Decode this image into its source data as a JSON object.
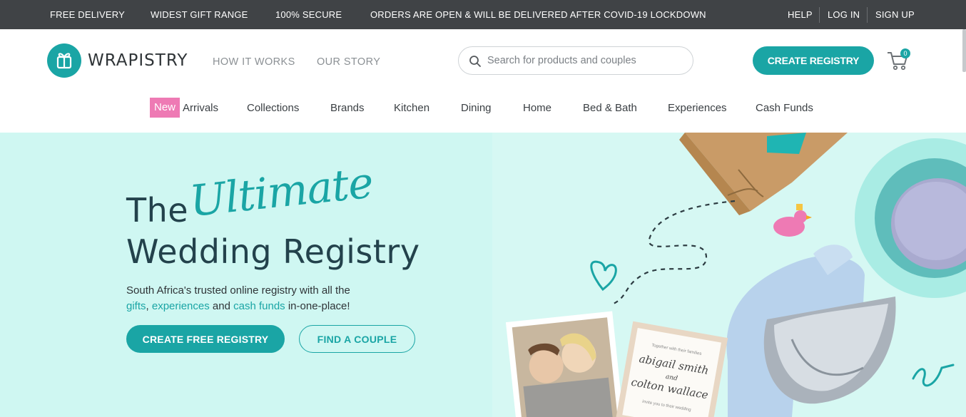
{
  "topbar": {
    "items": [
      "FREE DELIVERY",
      "WIDEST GIFT RANGE",
      "100% SECURE",
      "ORDERS ARE OPEN & WILL BE DELIVERED AFTER COVID-19 LOCKDOWN"
    ],
    "help": "HELP",
    "login": "LOG IN",
    "signup": "SIGN UP"
  },
  "header": {
    "brand": "WRAPISTRY",
    "nav": [
      "HOW IT WORKS",
      "OUR STORY"
    ],
    "search_placeholder": "Search for products and couples",
    "create_registry": "CREATE REGISTRY",
    "cart_count": "0"
  },
  "categories": {
    "new_badge": "New",
    "items": [
      "Arrivals",
      "Collections",
      "Brands",
      "Kitchen",
      "Dining",
      "Home",
      "Bed & Bath",
      "Experiences",
      "Cash Funds"
    ]
  },
  "hero": {
    "title_the": "The",
    "title_script": "Ultimate",
    "title_line2": "Wedding Registry",
    "desc_line1": "South Africa's trusted online registry with all the",
    "link_gifts": "gifts",
    "comma": ",",
    "link_experiences": "experiences",
    "and": "and",
    "link_cash": "cash funds",
    "desc_end": "in-one-place!",
    "btn_primary": "CREATE FREE REGISTRY",
    "btn_secondary": "FIND A COUPLE",
    "card_text": {
      "line_small": "Together with their families",
      "name1": "abigail smith",
      "and": "and",
      "name2": "colton wallace",
      "line_small2": "invite you to their wedding"
    }
  },
  "colors": {
    "accent": "#1aa5a5",
    "topbar_bg": "#404346",
    "hero_bg": "#cff7f2",
    "new_badge": "#ee7ab4",
    "heading": "#23424c"
  }
}
